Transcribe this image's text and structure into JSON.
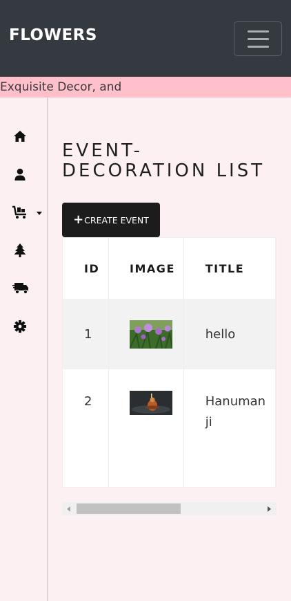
{
  "navbar": {
    "brand": "FLOWERS",
    "toggler_icon": "hamburger-icon",
    "background": "#343a40"
  },
  "marquee": {
    "text": "Exquisite Decor, and",
    "background": "#ffc0cb"
  },
  "sidebar": {
    "items": [
      {
        "icon": "home-icon"
      },
      {
        "icon": "user-icon"
      },
      {
        "icon": "cart-icon",
        "has_dropdown": true
      },
      {
        "icon": "tree-icon"
      },
      {
        "icon": "delivery-truck-icon"
      },
      {
        "icon": "gear-icon"
      }
    ]
  },
  "main": {
    "title": "EVENT-DECORATION LIST",
    "create_button": {
      "icon": "+",
      "label": "CREATE EVENT"
    },
    "table": {
      "headers": [
        "ID",
        "IMAGE",
        "TITLE"
      ],
      "rows": [
        {
          "id": "1",
          "image": "flower-photo",
          "title": "hello"
        },
        {
          "id": "2",
          "image": "temple-decor-photo",
          "title": "Hanuman ji"
        }
      ]
    }
  }
}
